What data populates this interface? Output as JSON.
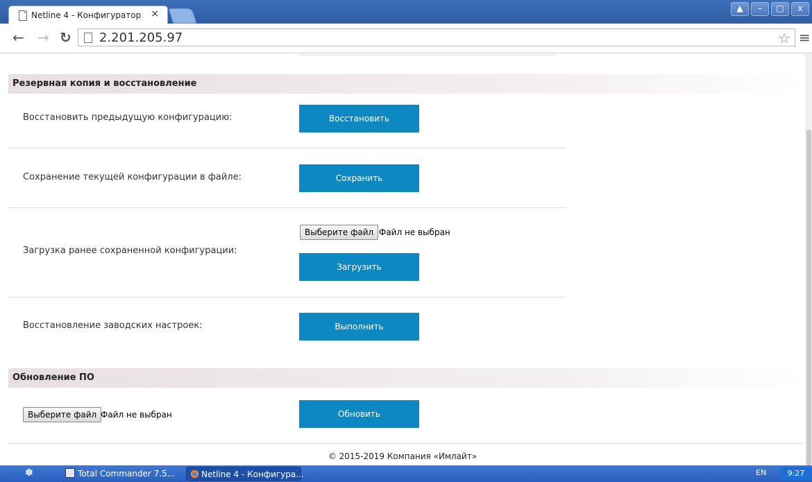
{
  "browser": {
    "tab_title": "Netline 4 - Конфигуратор",
    "tab_close": "×",
    "url": "2.201.205.97",
    "window_buttons": [
      "▲",
      "–",
      "□",
      "x"
    ]
  },
  "backup": {
    "header": "Резервная копия и восстановление",
    "restore_label": "Восстановить предыдущую конфигурацию:",
    "restore_button": "Восстановить",
    "save_label": "Сохранение текущей конфигурации в файле:",
    "save_button": "Сохранить",
    "upload_label": "Загрузка ранее сохраненной конфигурации:",
    "upload_file_button": "Выберите файл",
    "upload_file_status": "Файл не выбран",
    "upload_button": "Загрузить",
    "factory_label": "Восстановление заводских настроек:",
    "factory_button": "Выполнить"
  },
  "firmware": {
    "header": "Обновление ПО",
    "file_button": "Выберите файл",
    "file_status": "Файл не выбран",
    "update_button": "Обновить"
  },
  "footer": {
    "copyright": "© 2015-2019 Компания «Имлайт»"
  },
  "taskbar": {
    "items": [
      "Total Commander 7.5...",
      "Netline 4 - Конфигура..."
    ],
    "lang": "EN",
    "clock": "9:27"
  }
}
